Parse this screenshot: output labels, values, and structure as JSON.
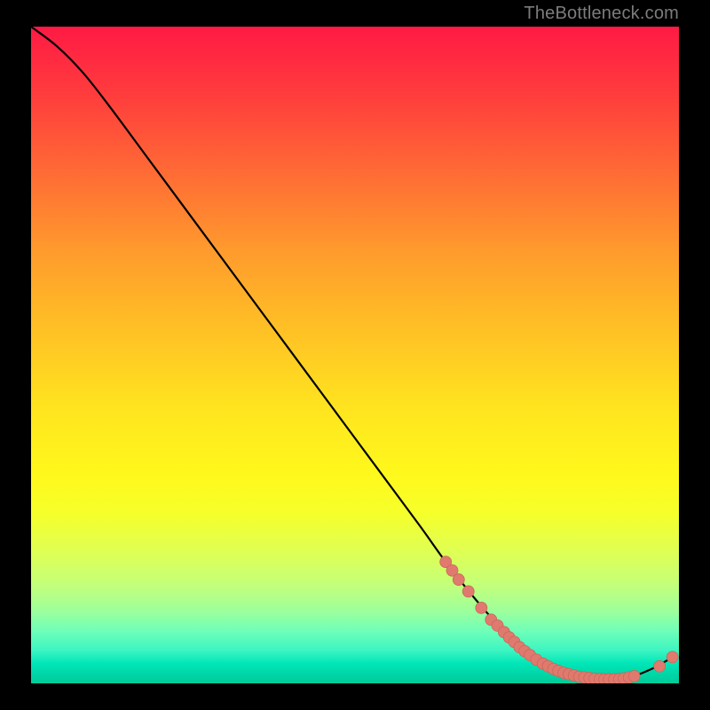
{
  "watermark": "TheBottleneck.com",
  "colors": {
    "curve_stroke": "#000000",
    "marker_fill": "#e07a6e",
    "marker_stroke": "#c9675b"
  },
  "chart_data": {
    "type": "line",
    "title": "",
    "xlabel": "",
    "ylabel": "",
    "xlim": [
      0,
      100
    ],
    "ylim": [
      0,
      100
    ],
    "grid": false,
    "legend": false,
    "series": [
      {
        "name": "curve",
        "x": [
          0,
          4,
          8,
          12,
          18,
          24,
          30,
          36,
          42,
          48,
          54,
          60,
          64,
          68,
          72,
          76,
          80,
          84,
          88,
          92,
          96,
          99
        ],
        "y": [
          100,
          97,
          93,
          88,
          80,
          72,
          64,
          56,
          48,
          40,
          32,
          24,
          18.5,
          13.5,
          9.0,
          5.5,
          3.0,
          1.4,
          0.6,
          0.8,
          2.3,
          4.0
        ]
      }
    ],
    "markers": [
      {
        "x": 64.0,
        "y": 18.5
      },
      {
        "x": 65.0,
        "y": 17.2
      },
      {
        "x": 66.0,
        "y": 15.8
      },
      {
        "x": 67.5,
        "y": 14.0
      },
      {
        "x": 69.5,
        "y": 11.5
      },
      {
        "x": 71.0,
        "y": 9.7
      },
      {
        "x": 72.0,
        "y": 8.8
      },
      {
        "x": 73.0,
        "y": 7.8
      },
      {
        "x": 73.8,
        "y": 7.0
      },
      {
        "x": 74.6,
        "y": 6.3
      },
      {
        "x": 75.4,
        "y": 5.5
      },
      {
        "x": 76.2,
        "y": 4.9
      },
      {
        "x": 77.0,
        "y": 4.3
      },
      {
        "x": 78.0,
        "y": 3.6
      },
      {
        "x": 79.0,
        "y": 3.0
      },
      {
        "x": 79.8,
        "y": 2.6
      },
      {
        "x": 80.6,
        "y": 2.2
      },
      {
        "x": 81.4,
        "y": 1.9
      },
      {
        "x": 82.2,
        "y": 1.6
      },
      {
        "x": 83.0,
        "y": 1.4
      },
      {
        "x": 83.8,
        "y": 1.2
      },
      {
        "x": 84.6,
        "y": 1.0
      },
      {
        "x": 85.4,
        "y": 0.9
      },
      {
        "x": 86.2,
        "y": 0.8
      },
      {
        "x": 87.0,
        "y": 0.7
      },
      {
        "x": 87.8,
        "y": 0.65
      },
      {
        "x": 88.5,
        "y": 0.6
      },
      {
        "x": 89.2,
        "y": 0.6
      },
      {
        "x": 90.0,
        "y": 0.6
      },
      {
        "x": 90.8,
        "y": 0.65
      },
      {
        "x": 91.5,
        "y": 0.75
      },
      {
        "x": 92.3,
        "y": 0.9
      },
      {
        "x": 93.1,
        "y": 1.1
      },
      {
        "x": 97.0,
        "y": 2.6
      },
      {
        "x": 99.0,
        "y": 4.0
      }
    ]
  }
}
